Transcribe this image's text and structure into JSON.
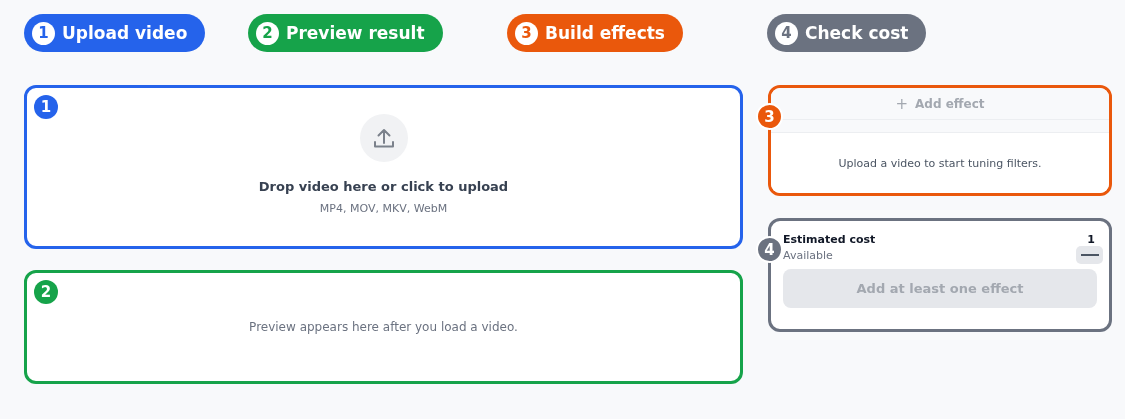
{
  "steps": [
    {
      "number": "1",
      "label": "Upload video",
      "color": "#2563eb"
    },
    {
      "number": "2",
      "label": "Preview result",
      "color": "#16a34a"
    },
    {
      "number": "3",
      "label": "Build effects",
      "color": "#ea580c"
    },
    {
      "number": "4",
      "label": "Check cost",
      "color": "#6b7280"
    }
  ],
  "upload_panel": {
    "badge": "1",
    "color": "#2563eb",
    "title": "Drop video here or click to upload",
    "formats": "MP4, MOV, MKV, WebM"
  },
  "preview_panel": {
    "badge": "2",
    "color": "#16a34a",
    "message": "Preview appears here after you load a video."
  },
  "effects_panel": {
    "badge": "3",
    "color": "#ea580c",
    "add_button": {
      "icon": "+",
      "label": "Add effect",
      "disabled": true
    },
    "message": "Upload a video to start tuning filters."
  },
  "cost_panel": {
    "badge": "4",
    "color": "#6b7280",
    "title": "Estimated cost",
    "value": "1",
    "available_label": "Available",
    "action_button": {
      "label": "Add at least one effect",
      "disabled": true
    }
  }
}
